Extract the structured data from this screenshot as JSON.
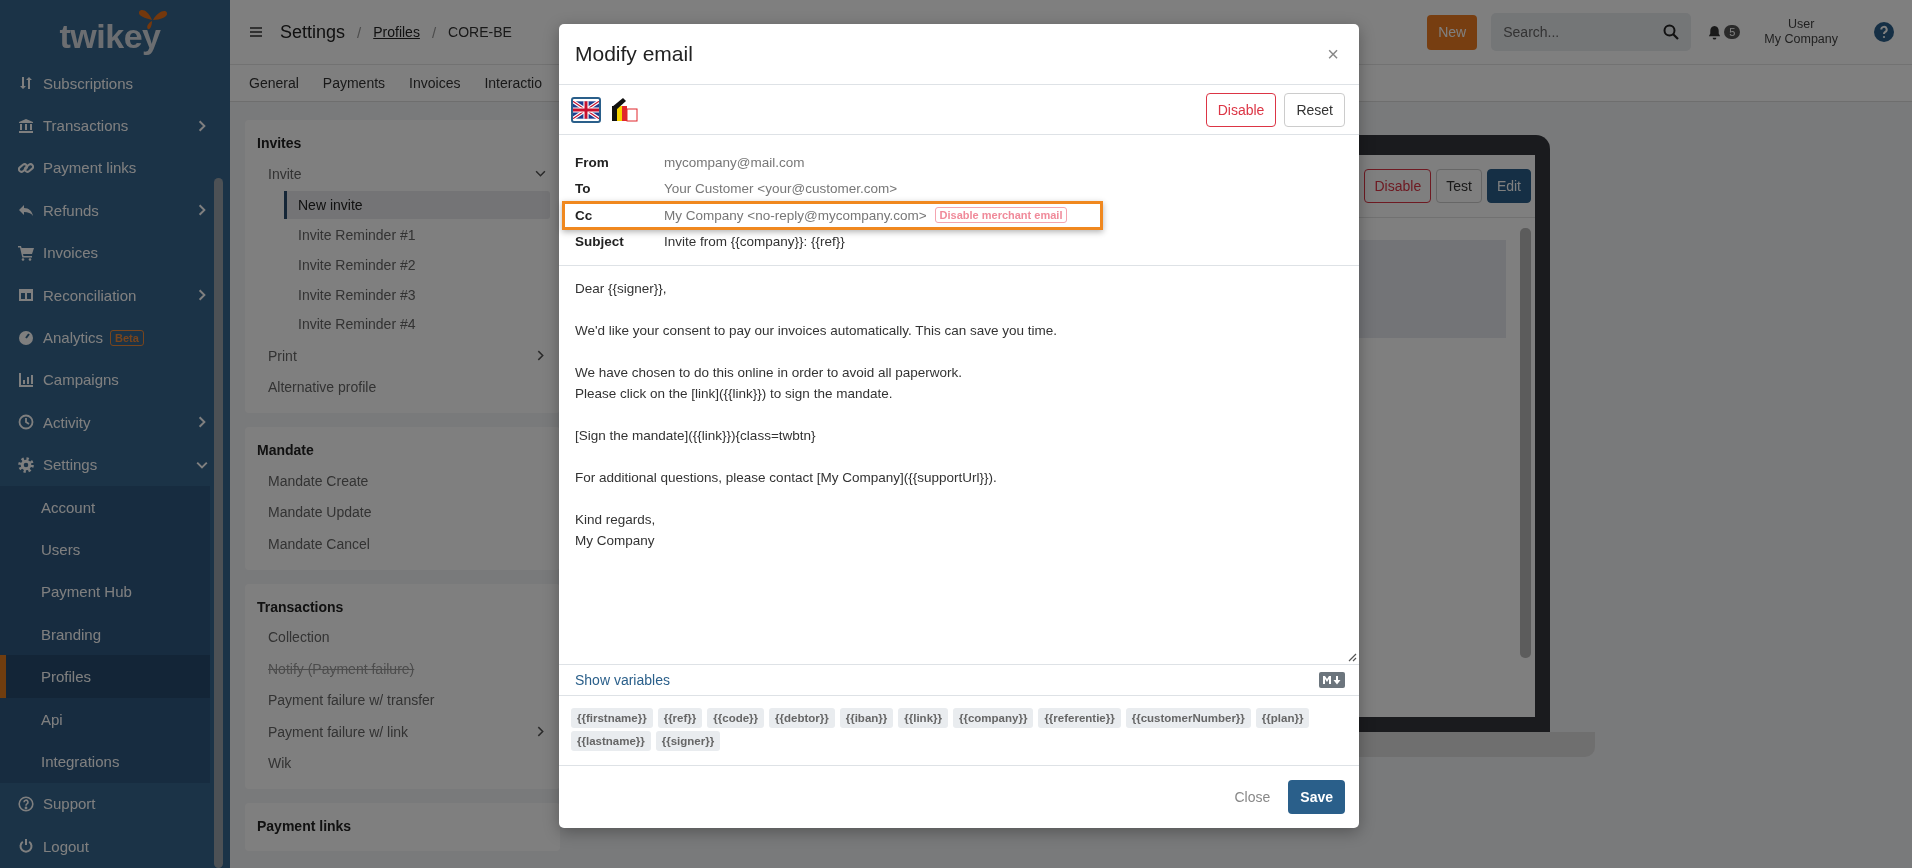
{
  "sidebar": {
    "logo": "twikey",
    "items": [
      {
        "label": "Subscriptions",
        "kind": "link"
      },
      {
        "label": "Transactions",
        "kind": "group",
        "expanded": false
      },
      {
        "label": "Payment links",
        "kind": "link"
      },
      {
        "label": "Refunds",
        "kind": "group",
        "expanded": false
      },
      {
        "label": "Invoices",
        "kind": "link"
      },
      {
        "label": "Reconciliation",
        "kind": "group",
        "expanded": false
      },
      {
        "label": "Analytics",
        "kind": "link",
        "badge": "Beta"
      },
      {
        "label": "Campaigns",
        "kind": "link"
      },
      {
        "label": "Activity",
        "kind": "group",
        "expanded": false
      },
      {
        "label": "Settings",
        "kind": "group",
        "expanded": true,
        "children": [
          {
            "label": "Account",
            "selected": false
          },
          {
            "label": "Users",
            "selected": false
          },
          {
            "label": "Payment Hub",
            "selected": false
          },
          {
            "label": "Branding",
            "selected": false
          },
          {
            "label": "Profiles",
            "selected": true
          },
          {
            "label": "Api",
            "selected": false
          },
          {
            "label": "Integrations",
            "selected": false
          }
        ]
      },
      {
        "label": "Support",
        "kind": "link"
      },
      {
        "label": "Logout",
        "kind": "link"
      }
    ]
  },
  "topbar": {
    "breadcrumb": [
      {
        "kind": "title",
        "label": "Settings"
      },
      {
        "kind": "separator",
        "label": "/"
      },
      {
        "kind": "link",
        "label": "Profiles"
      },
      {
        "kind": "separator",
        "label": "/"
      },
      {
        "kind": "text",
        "label": "CORE-BE"
      }
    ],
    "new_button": "New",
    "search": {
      "placeholder": "Search..."
    },
    "notifications": {
      "count": "5"
    },
    "user": {
      "name": "User",
      "company": "My Company"
    }
  },
  "tabs": [
    "General",
    "Payments",
    "Invoices",
    "Interactio"
  ],
  "sections": [
    {
      "title": "Invites",
      "items": [
        {
          "label": "Invite",
          "kind": "group",
          "expanded": true,
          "disabled": false,
          "children": [
            {
              "label": "New invite",
              "selected": true
            },
            {
              "label": "Invite Reminder #1",
              "selected": false
            },
            {
              "label": "Invite Reminder #2",
              "selected": false
            },
            {
              "label": "Invite Reminder #3",
              "selected": false
            },
            {
              "label": "Invite Reminder #4",
              "selected": false
            }
          ]
        },
        {
          "label": "Print",
          "kind": "group",
          "expanded": false,
          "disabled": false
        },
        {
          "label": "Alternative profile",
          "kind": "link",
          "disabled": false
        }
      ]
    },
    {
      "title": "Mandate",
      "items": [
        {
          "label": "Mandate Create",
          "kind": "link",
          "disabled": false
        },
        {
          "label": "Mandate Update",
          "kind": "link",
          "disabled": false
        },
        {
          "label": "Mandate Cancel",
          "kind": "link",
          "disabled": false
        }
      ]
    },
    {
      "title": "Transactions",
      "items": [
        {
          "label": "Collection",
          "kind": "link",
          "disabled": false
        },
        {
          "label": "Notify (Payment failure)",
          "kind": "link",
          "disabled": true
        },
        {
          "label": "Payment failure w/ transfer",
          "kind": "link",
          "disabled": false
        },
        {
          "label": "Payment failure w/ link",
          "kind": "group",
          "expanded": false,
          "disabled": false
        },
        {
          "label": "Wik",
          "kind": "link",
          "disabled": false
        }
      ]
    },
    {
      "title": "Payment links"
    }
  ],
  "preview": {
    "buttons": [
      {
        "label": "Disable",
        "kind": "danger"
      },
      {
        "label": "Test",
        "kind": "default"
      },
      {
        "label": "Edit",
        "kind": "primary"
      }
    ]
  },
  "modal": {
    "title": "Modify email",
    "close": "×",
    "languages": [
      {
        "selected": true
      },
      {
        "selected": false
      }
    ],
    "actions": [
      {
        "label": "Disable",
        "kind": "danger"
      },
      {
        "label": "Reset",
        "kind": "default"
      }
    ],
    "fields": [
      {
        "label": "From",
        "value": "mycompany@mail.com",
        "kind": "static",
        "highlighted": false
      },
      {
        "label": "To",
        "value": "Your Customer <your@customer.com>",
        "kind": "static",
        "highlighted": false
      },
      {
        "label": "Cc",
        "value": "My Company <no-reply@mycompany.com>",
        "kind": "static",
        "highlighted": true,
        "badge": "Disable merchant email"
      },
      {
        "label": "Subject",
        "value": "Invite from {{company}}: {{ref}}",
        "kind": "input",
        "highlighted": false
      }
    ],
    "body": [
      [
        "Dear {{signer}},"
      ],
      [
        "We'd like your consent to pay our invoices automatically. This can save you time."
      ],
      [
        "We have chosen to do this online in order to avoid all paperwork.",
        "Please click on the [link]({{link}}) to sign the mandate."
      ],
      [
        "[Sign the mandate]({{link}}){class=twbtn}"
      ],
      [
        "For additional questions, please contact [My Company]({{supportUrl}})."
      ],
      [
        "Kind regards,",
        "My Company"
      ]
    ],
    "show_variables": "Show variables",
    "variables": [
      "{{firstname}}",
      "{{ref}}",
      "{{code}}",
      "{{debtor}}",
      "{{iban}}",
      "{{link}}",
      "{{company}}",
      "{{referentie}}",
      "{{customerNumber}}",
      "{{plan}}",
      "{{lastname}}",
      "{{signer}}"
    ],
    "footer": {
      "close": "Close",
      "save": "Save"
    }
  }
}
